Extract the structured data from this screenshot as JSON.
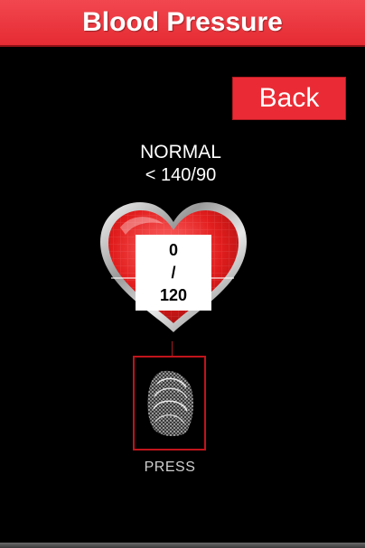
{
  "header": {
    "title": "Blood Pressure"
  },
  "back_button": {
    "label": "Back"
  },
  "status": {
    "label": "NORMAL",
    "threshold": "< 140/90"
  },
  "reading": {
    "top": "0",
    "separator": "/",
    "bottom": "120"
  },
  "sensor": {
    "label": "PRESS"
  },
  "colors": {
    "accent": "#e52b33",
    "sensor_border": "#c0141b",
    "background": "#000000"
  },
  "icons": {
    "heart": "heart-icon",
    "fingerprint": "fingerprint-icon"
  }
}
